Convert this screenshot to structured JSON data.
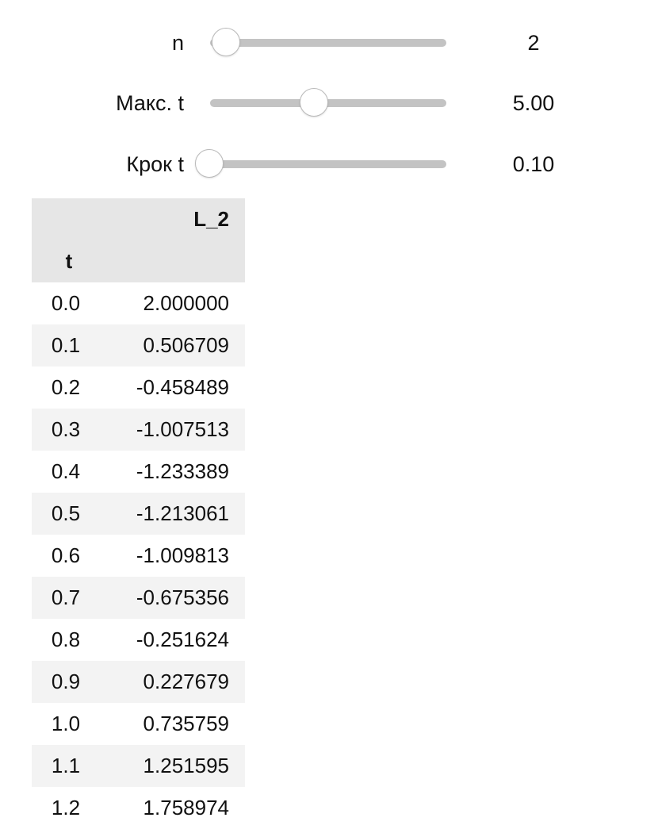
{
  "sliders": [
    {
      "label": "n",
      "value_text": "2",
      "value": 2,
      "min": 1,
      "max": 15
    },
    {
      "label": "Макс. t",
      "value_text": "5.00",
      "value": 5.0,
      "min": 1.0,
      "max": 10.0
    },
    {
      "label": "Крок t",
      "value_text": "0.10",
      "value": 0.1,
      "min": 0.1,
      "max": 1.0
    }
  ],
  "table": {
    "column_header": "L_2",
    "index_header": "t",
    "rows": [
      {
        "t": "0.0",
        "value": "2.000000"
      },
      {
        "t": "0.1",
        "value": "0.506709"
      },
      {
        "t": "0.2",
        "value": "-0.458489"
      },
      {
        "t": "0.3",
        "value": "-1.007513"
      },
      {
        "t": "0.4",
        "value": "-1.233389"
      },
      {
        "t": "0.5",
        "value": "-1.213061"
      },
      {
        "t": "0.6",
        "value": "-1.009813"
      },
      {
        "t": "0.7",
        "value": "-0.675356"
      },
      {
        "t": "0.8",
        "value": "-0.251624"
      },
      {
        "t": "0.9",
        "value": "0.227679"
      },
      {
        "t": "1.0",
        "value": "0.735759"
      },
      {
        "t": "1.1",
        "value": "1.251595"
      },
      {
        "t": "1.2",
        "value": "1.758974"
      }
    ]
  }
}
